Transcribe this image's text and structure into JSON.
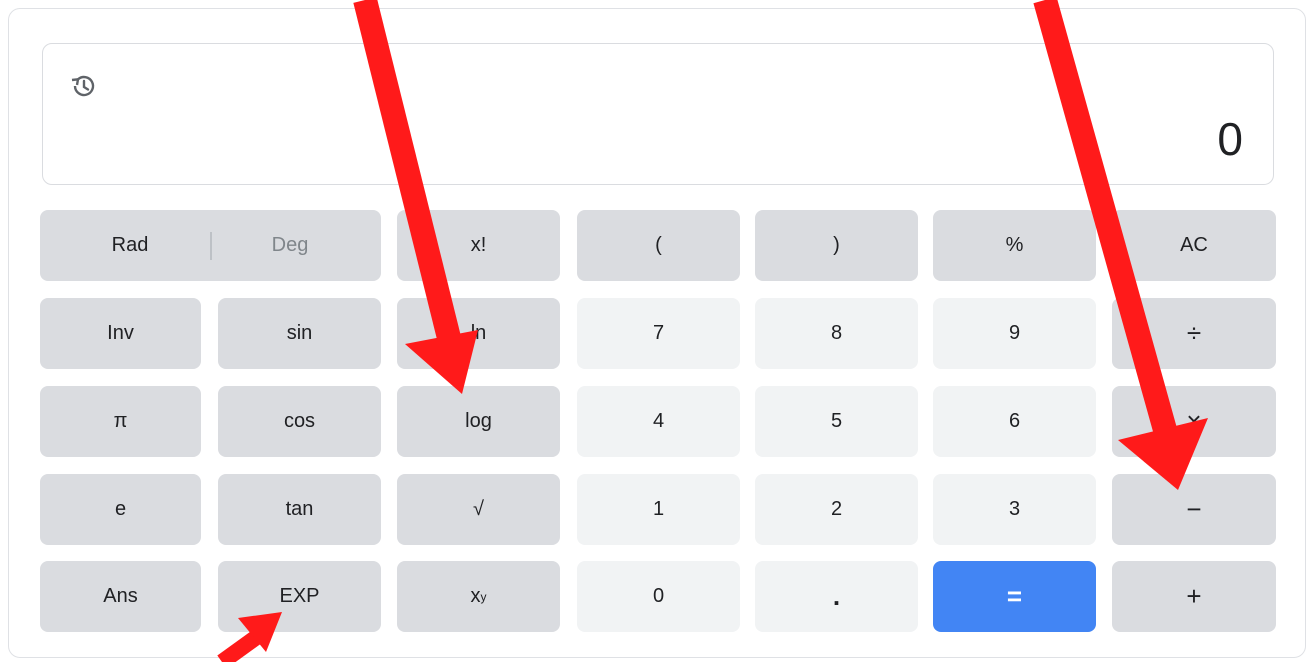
{
  "display": {
    "value": "0",
    "history_icon": "history-icon"
  },
  "keys": {
    "rad": "Rad",
    "deg": "Deg",
    "factorial": "x!",
    "open_paren": "(",
    "close_paren": ")",
    "percent": "%",
    "clear": "AC",
    "inv": "Inv",
    "sin": "sin",
    "ln": "ln",
    "seven": "7",
    "eight": "8",
    "nine": "9",
    "divide": "÷",
    "pi": "π",
    "cos": "cos",
    "log": "log",
    "four": "4",
    "five": "5",
    "six": "6",
    "multiply": "×",
    "e": "e",
    "tan": "tan",
    "sqrt": "√",
    "one": "1",
    "two": "2",
    "three": "3",
    "minus": "−",
    "ans": "Ans",
    "exp": "EXP",
    "power_base": "x",
    "power_exp": "y",
    "zero": "0",
    "decimal": ".",
    "equals": "=",
    "plus": "+"
  },
  "colors": {
    "function_key": "#dadce0",
    "number_key": "#f1f3f4",
    "equals_key": "#4285f4",
    "annotation_arrow": "#ff1a1a"
  }
}
